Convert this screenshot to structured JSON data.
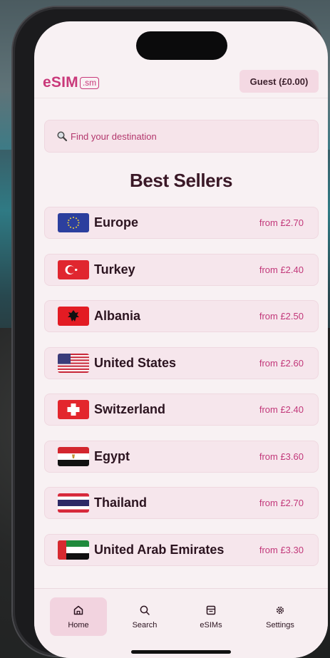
{
  "header": {
    "logo_text": "eSIM",
    "logo_suffix": ".sm",
    "account_label": "Guest (£0.00)"
  },
  "search": {
    "placeholder": "Find your destination",
    "icon": "magnifier-icon"
  },
  "section_title": "Best Sellers",
  "destinations": [
    {
      "name": "Europe",
      "price": "from £2.70",
      "flag": "eu-flag"
    },
    {
      "name": "Turkey",
      "price": "from £2.40",
      "flag": "turkey-flag"
    },
    {
      "name": "Albania",
      "price": "from £2.50",
      "flag": "albania-flag"
    },
    {
      "name": "United States",
      "price": "from £2.60",
      "flag": "usa-flag"
    },
    {
      "name": "Switzerland",
      "price": "from £2.40",
      "flag": "switzerland-flag"
    },
    {
      "name": "Egypt",
      "price": "from £3.60",
      "flag": "egypt-flag"
    },
    {
      "name": "Thailand",
      "price": "from £2.70",
      "flag": "thailand-flag"
    },
    {
      "name": "United Arab Emirates",
      "price": "from £3.30",
      "flag": "uae-flag"
    }
  ],
  "tabs": [
    {
      "label": "Home",
      "icon": "home-icon",
      "active": true
    },
    {
      "label": "Search",
      "icon": "search-icon",
      "active": false
    },
    {
      "label": "eSIMs",
      "icon": "sim-card-icon",
      "active": false
    },
    {
      "label": "Settings",
      "icon": "gear-icon",
      "active": false
    }
  ],
  "colors": {
    "accent": "#c9397a",
    "row_bg": "#f6e6ec",
    "active_tab_bg": "#f2d3df",
    "screen_bg": "#f8f1f3"
  }
}
